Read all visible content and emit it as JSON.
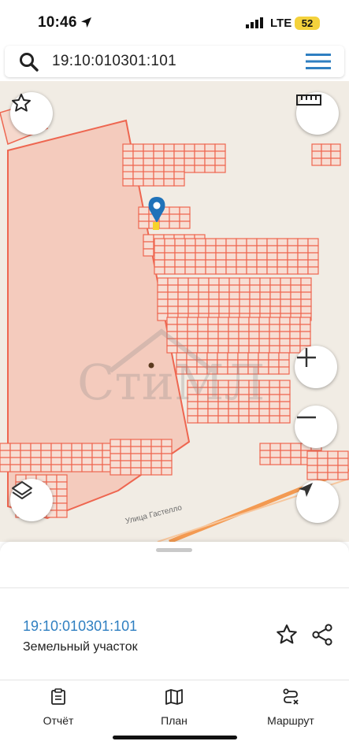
{
  "status_bar": {
    "time": "10:46",
    "network": "LTE",
    "battery": "52"
  },
  "search": {
    "query": "19:10:010301:101"
  },
  "map": {
    "watermark": "СтиМЛ",
    "street_label": "Улица Гастелло",
    "street_label_2": "",
    "colors": {
      "plot_stroke": "#ee6650",
      "plot_fill": "#f7ded4",
      "large_area": "#f4c9bb",
      "road": "#f39a52",
      "marker": "#1f72b9"
    }
  },
  "panel": {
    "cadastral_number": "19:10:010301:101",
    "object_type": "Земельный участок"
  },
  "tabs": [
    {
      "label": "Отчёт",
      "icon": "report-icon"
    },
    {
      "label": "План",
      "icon": "map-plan-icon"
    },
    {
      "label": "Маршрут",
      "icon": "route-icon"
    }
  ]
}
